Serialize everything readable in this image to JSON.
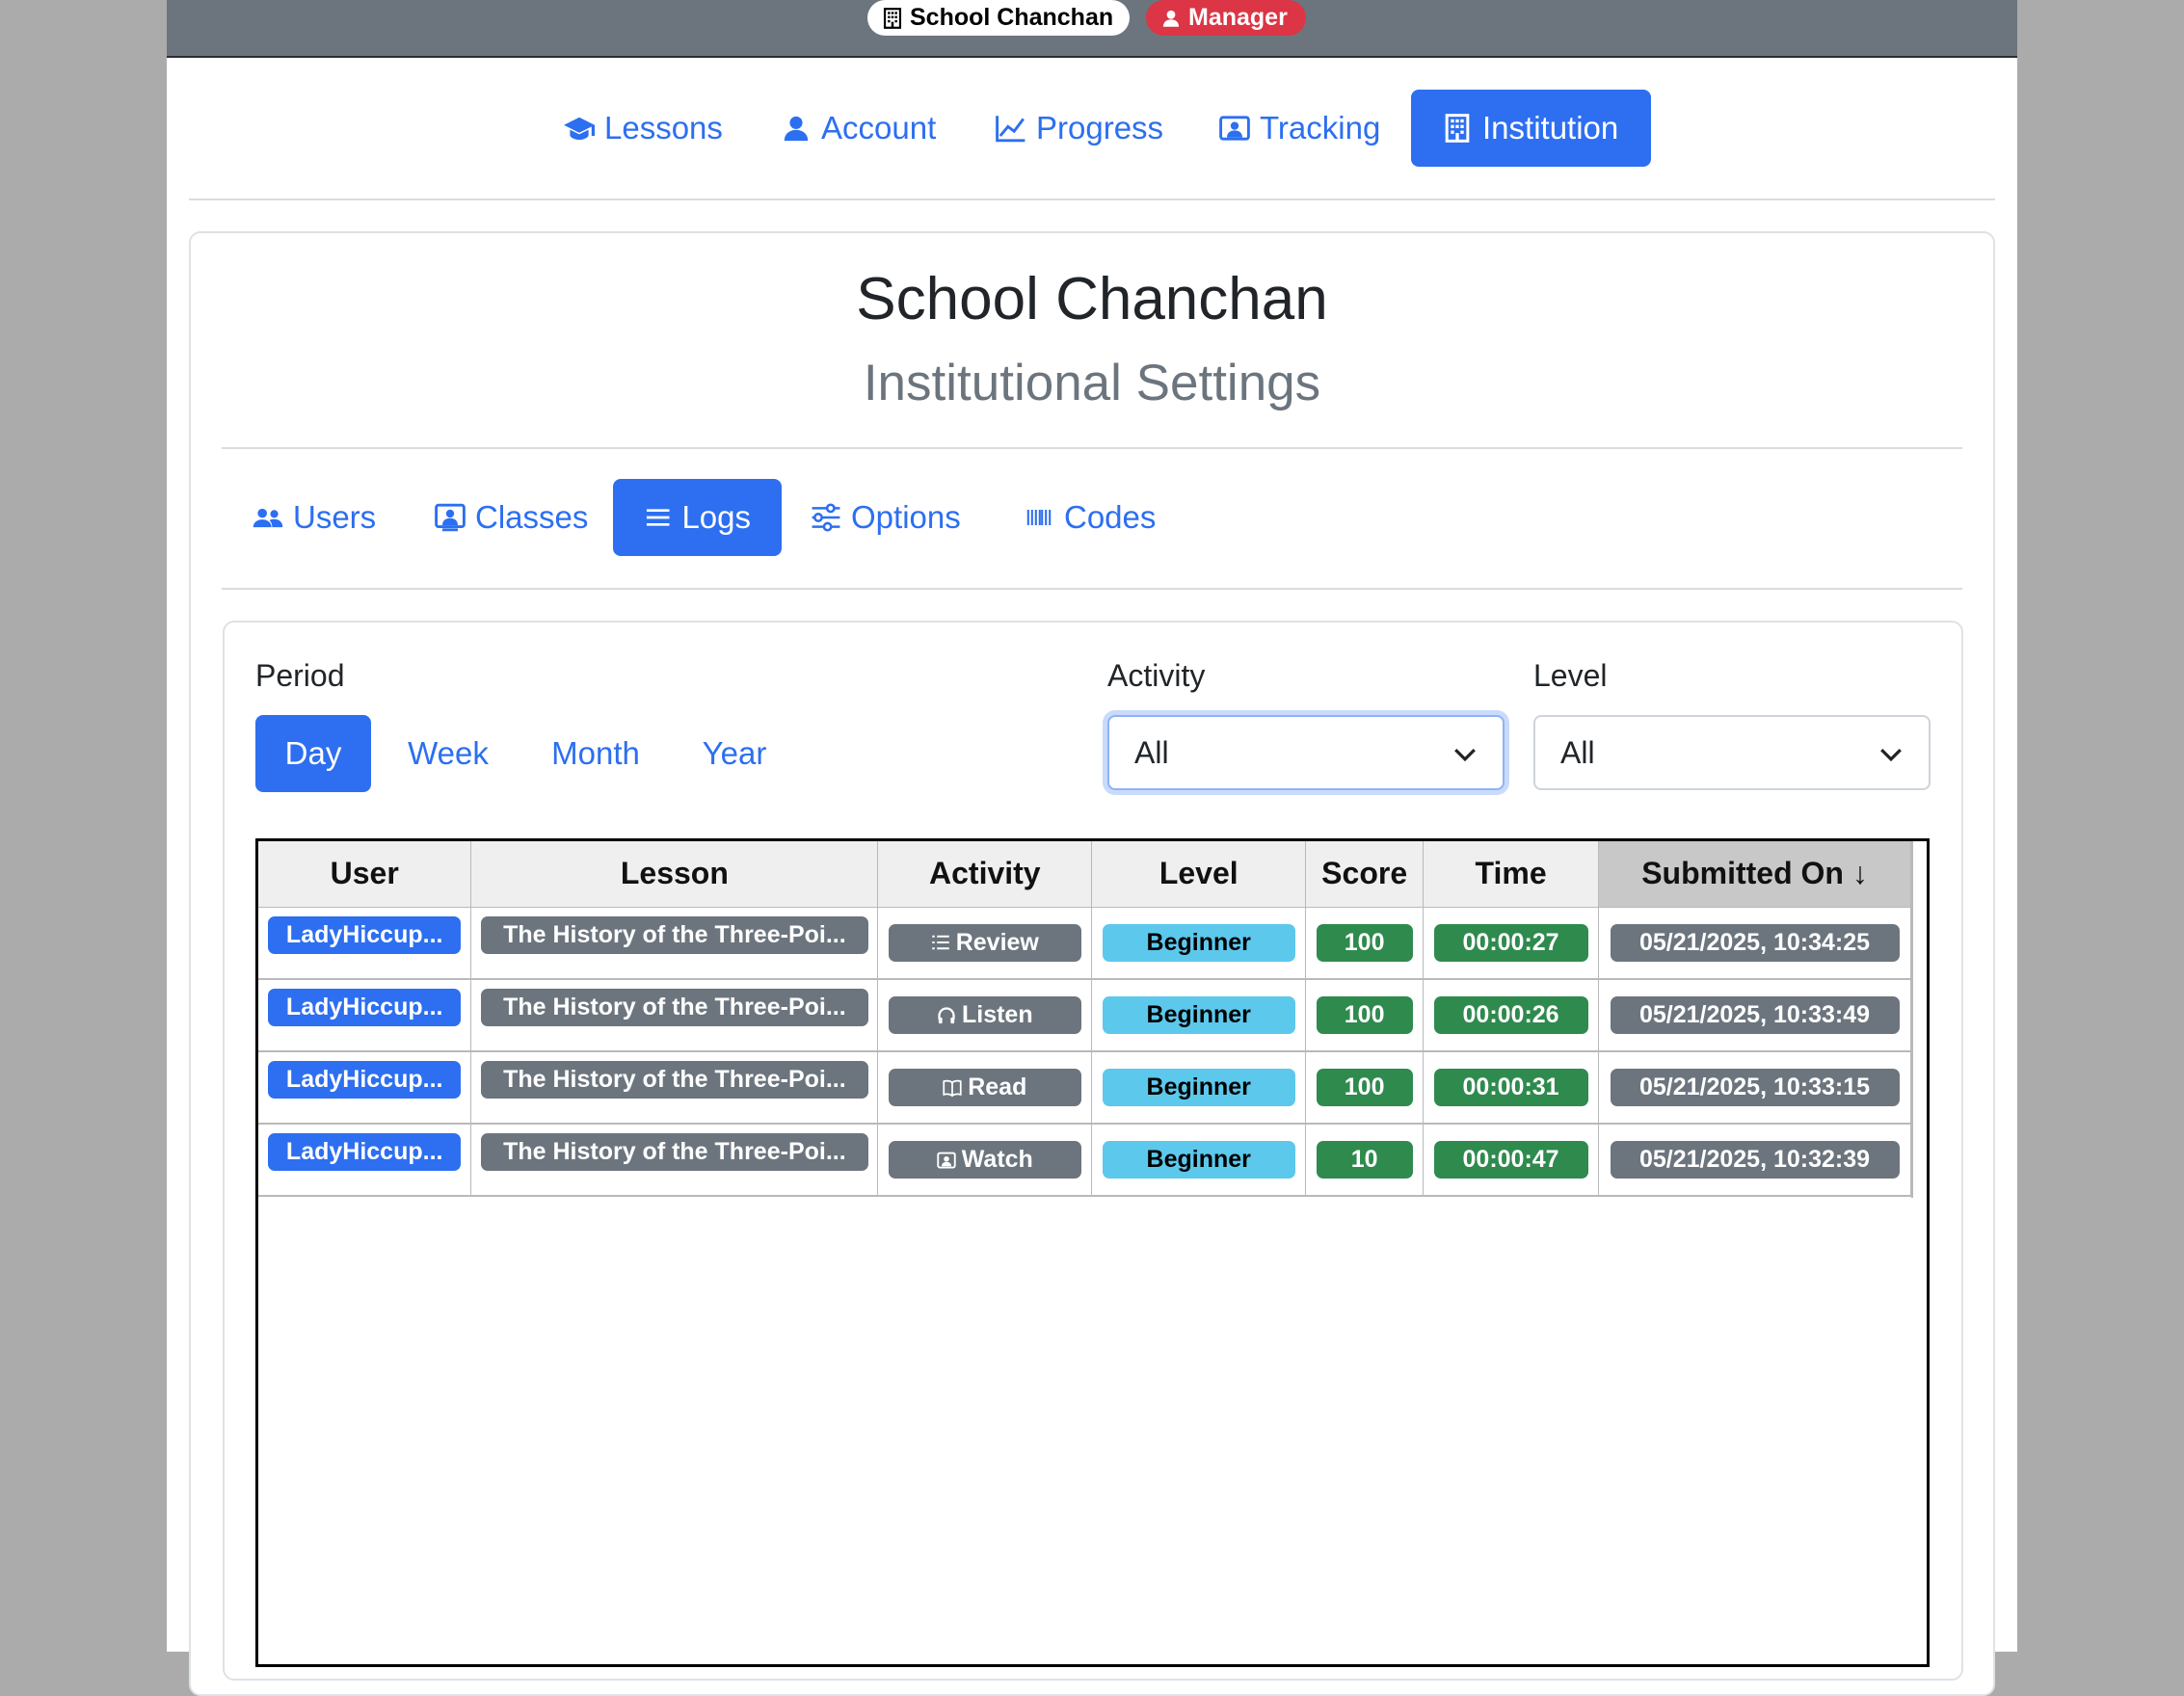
{
  "topbar": {
    "institution_badge": "School Chanchan",
    "role_badge": "Manager"
  },
  "main_nav": {
    "lessons": "Lessons",
    "account": "Account",
    "progress": "Progress",
    "tracking": "Tracking",
    "institution": "Institution"
  },
  "header": {
    "title": "School Chanchan",
    "subtitle": "Institutional Settings"
  },
  "sub_nav": {
    "users": "Users",
    "classes": "Classes",
    "logs": "Logs",
    "options": "Options",
    "codes": "Codes"
  },
  "filters": {
    "period_label": "Period",
    "period_options": [
      "Day",
      "Week",
      "Month",
      "Year"
    ],
    "period_selected": "Day",
    "activity_label": "Activity",
    "activity_value": "All",
    "level_label": "Level",
    "level_value": "All"
  },
  "table": {
    "columns": [
      "User",
      "Lesson",
      "Activity",
      "Level",
      "Score",
      "Time",
      "Submitted On"
    ],
    "sort_indicator": "↓",
    "rows": [
      {
        "user": "LadyHiccup...",
        "lesson": "The History of the Three-Poi...",
        "activity": "Review",
        "activity_icon": "list-icon",
        "level": "Beginner",
        "score": "100",
        "time": "00:00:27",
        "submitted": "05/21/2025, 10:34:25"
      },
      {
        "user": "LadyHiccup...",
        "lesson": "The History of the Three-Poi...",
        "activity": "Listen",
        "activity_icon": "headphones-icon",
        "level": "Beginner",
        "score": "100",
        "time": "00:00:26",
        "submitted": "05/21/2025, 10:33:49"
      },
      {
        "user": "LadyHiccup...",
        "lesson": "The History of the Three-Poi...",
        "activity": "Read",
        "activity_icon": "book-icon",
        "level": "Beginner",
        "score": "100",
        "time": "00:00:31",
        "submitted": "05/21/2025, 10:33:15"
      },
      {
        "user": "LadyHiccup...",
        "lesson": "The History of the Three-Poi...",
        "activity": "Watch",
        "activity_icon": "video-icon",
        "level": "Beginner",
        "score": "10",
        "time": "00:00:47",
        "submitted": "05/21/2025, 10:32:39"
      }
    ]
  },
  "colors": {
    "primary": "#2d6ff0",
    "secondary": "#6c757d",
    "success": "#2f8a4e",
    "info": "#5cc8ec",
    "danger": "#dc3545"
  }
}
